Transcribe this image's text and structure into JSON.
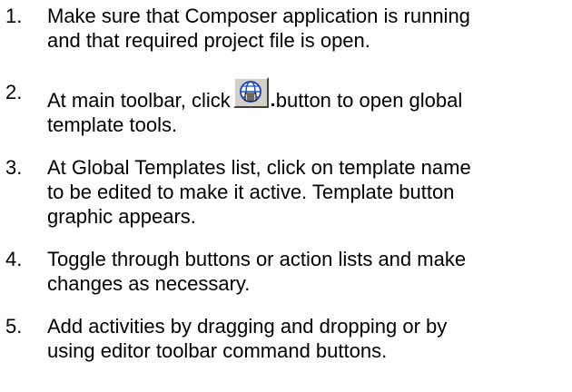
{
  "steps": [
    {
      "number": "1.",
      "lines": [
        "Make sure that Composer application is running",
        "and that required project file is open."
      ]
    },
    {
      "number": "2.",
      "line1_before": "At main toolbar, click",
      "line1_after": "button to open global",
      "line2": "template tools.",
      "button_icon": "global-templates-icon"
    },
    {
      "number": "3.",
      "lines": [
        "At Global Templates list, click on template name",
        "to be edited to make it active.  Template button",
        "graphic appears."
      ]
    },
    {
      "number": "4.",
      "lines": [
        "Toggle through buttons or action lists and make",
        "changes as necessary."
      ]
    },
    {
      "number": "5.",
      "lines": [
        "Add activities by dragging and dropping or by",
        "using editor toolbar command buttons."
      ]
    }
  ],
  "colors": {
    "text": "#000000",
    "button_face": "#d4d0c8",
    "icon_blue": "#1f4fbf"
  }
}
